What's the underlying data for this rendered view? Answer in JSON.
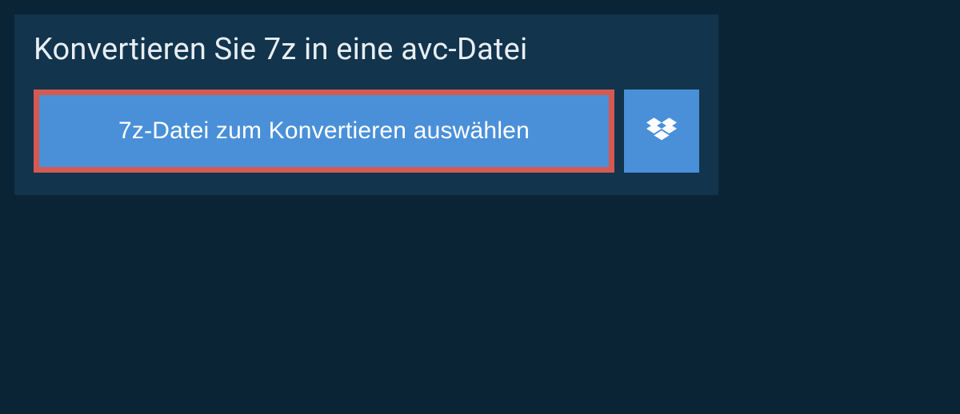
{
  "heading": "Konvertieren Sie 7z in eine avc-Datei",
  "buttons": {
    "select_file_label": "7z-Datei zum Konvertieren auswählen",
    "dropbox_icon_name": "dropbox-icon"
  },
  "colors": {
    "page_bg": "#0a2436",
    "panel_bg": "#12344d",
    "button_bg": "#4a90d9",
    "highlight_border": "#d45a52",
    "text": "#e8eef2"
  }
}
